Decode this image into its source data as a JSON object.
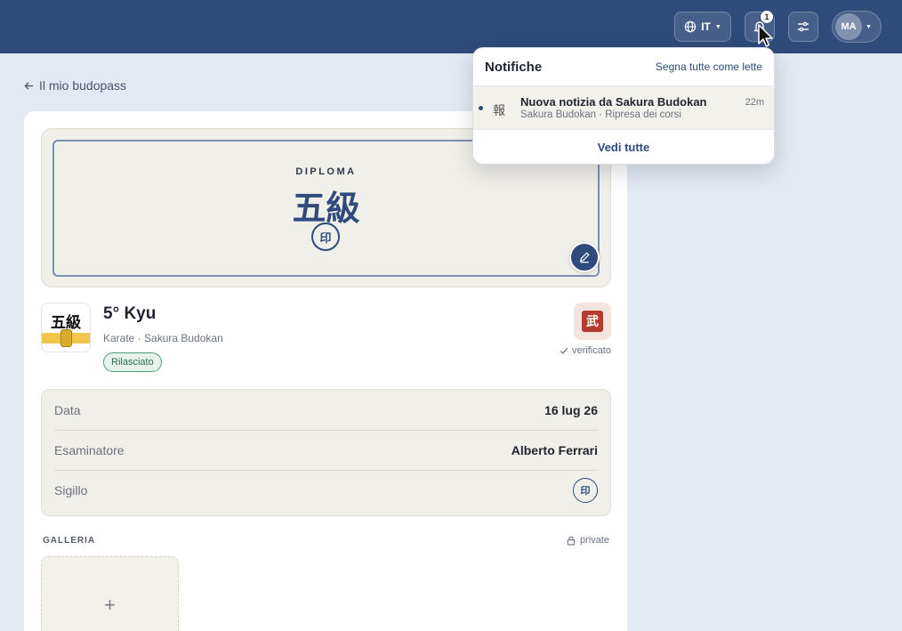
{
  "topbar": {
    "language": "IT",
    "notification_count": "1",
    "user_initials": "MA"
  },
  "nav": {
    "back_label": "Il mio budopass"
  },
  "diploma": {
    "label": "DIPLOMA",
    "kanji": "五級",
    "seal": "印"
  },
  "rank": {
    "logo_kanji": "五級",
    "title": "5° Kyu",
    "subtitle": "Karate · Sakura Budokan",
    "status": "Rilasciato",
    "org_badge": "武",
    "verified": "verificato"
  },
  "details": {
    "rows": [
      {
        "label": "Data",
        "value": "16 lug 26"
      },
      {
        "label": "Esaminatore",
        "value": "Alberto Ferrari"
      },
      {
        "label": "Sigillo",
        "value": "印"
      }
    ]
  },
  "gallery": {
    "label": "GALLERIA",
    "visibility": "private",
    "add_symbol": "+"
  },
  "notifications": {
    "title": "Notifiche",
    "mark_all": "Segna tutte come lette",
    "items": [
      {
        "icon": "報",
        "title": "Nuova notizia da Sakura Budokan",
        "subtitle": "Sakura Budokan · Ripresa dei corsi",
        "time": "22m"
      }
    ],
    "view_all": "Vedi tutte"
  },
  "colors": {
    "primary": "#2e4b7c",
    "background": "#e3e9f2",
    "status_green": "#4f9a77",
    "org_red": "#b43b2e"
  }
}
